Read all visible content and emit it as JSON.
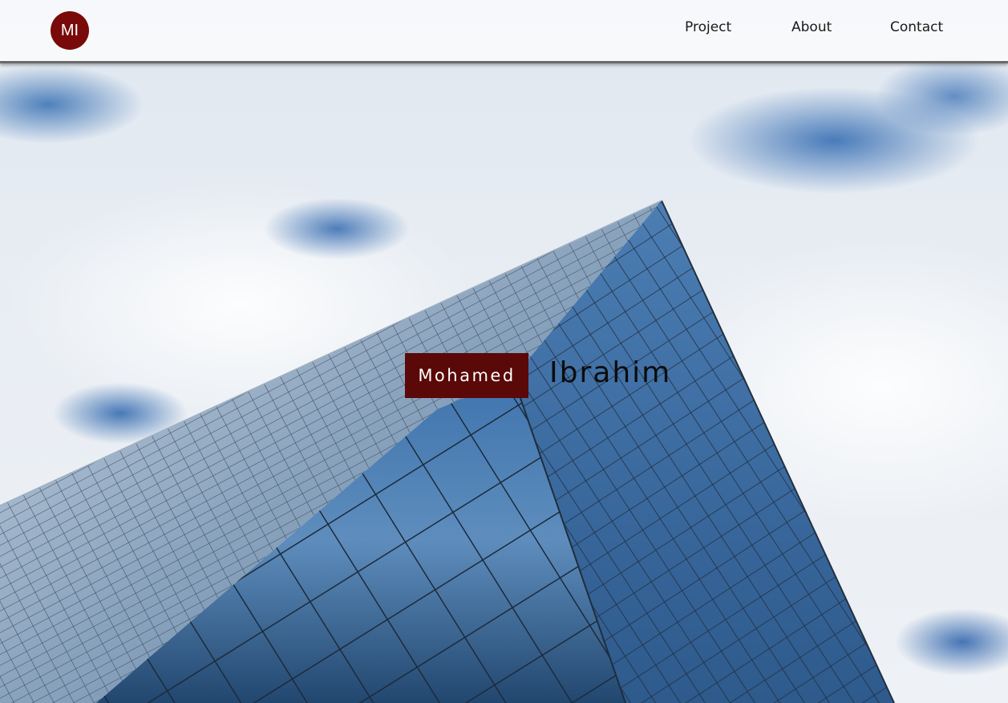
{
  "header": {
    "logo_text": "MI",
    "nav": [
      {
        "label": "Project"
      },
      {
        "label": "About"
      },
      {
        "label": "Contact"
      }
    ]
  },
  "hero": {
    "first_name": "Mohamed",
    "last_name": "Ibrahim",
    "background_image": "glass-skyscraper-against-cloudy-sky"
  },
  "colors": {
    "brand": "#7a0a0a",
    "name_badge": "#5a0808",
    "header_border": "#6b6b6b"
  }
}
